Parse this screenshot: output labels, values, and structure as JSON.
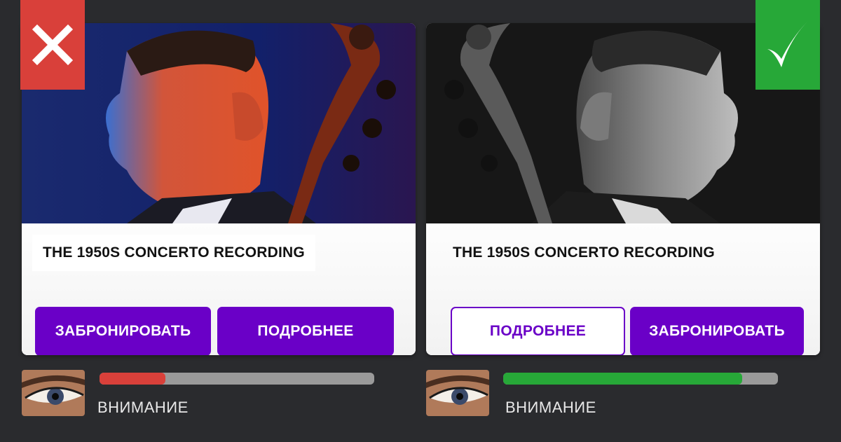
{
  "left_card": {
    "title": "THE 1950S CONCERTO RECORDING",
    "buttons": [
      "ЗАБРОНИРОВАТЬ",
      "ПОДРОБНЕЕ"
    ]
  },
  "right_card": {
    "title": "THE 1950S CONCERTO RECORDING",
    "buttons": [
      "ПОДРОБНЕЕ",
      "ЗАБРОНИРОВАТЬ"
    ]
  },
  "left_meter": {
    "label": "ВНИМАНИЕ",
    "level": 0.24,
    "color": "#d9403a"
  },
  "right_meter": {
    "label": "ВНИМАНИЕ",
    "level": 0.87,
    "color": "#27a838"
  },
  "badges": {
    "bad": "x-icon",
    "good": "checkmark-icon"
  },
  "colors": {
    "accent": "#6a00c7",
    "bad": "#d9403a",
    "good": "#27a838"
  }
}
